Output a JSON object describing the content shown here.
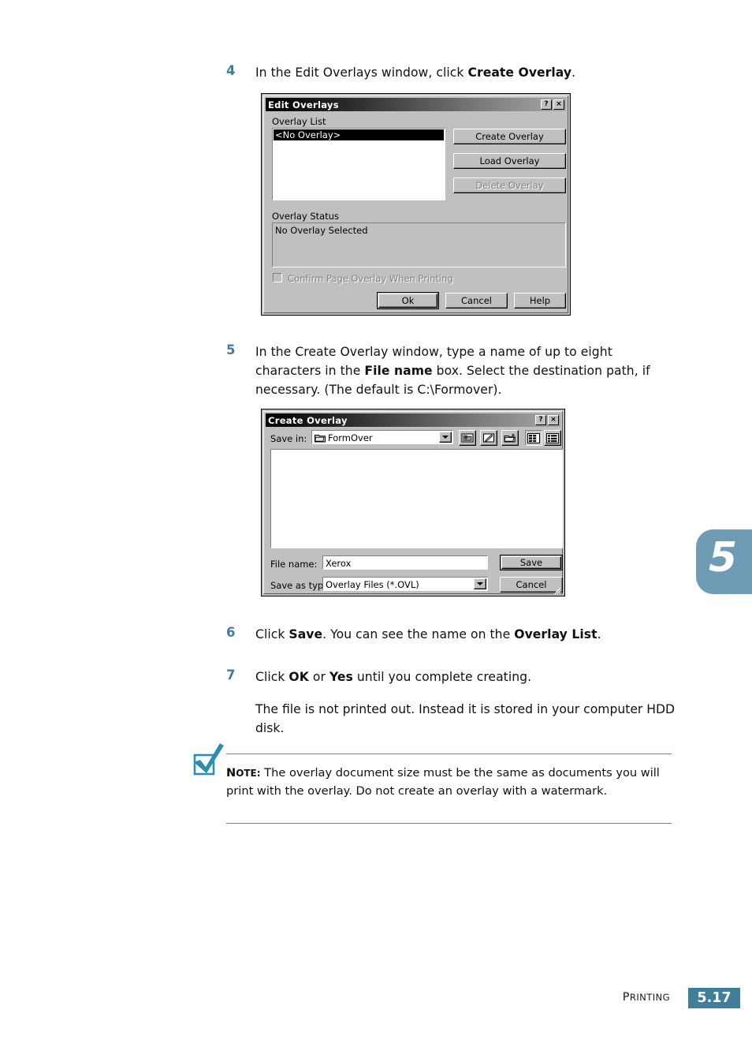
{
  "page": {
    "chapter_tab_number": "5",
    "footer_label": "PRINTING",
    "footer_page": "5.17",
    "accent_color": "#3f7e96",
    "tab_color": "#6d9cb4"
  },
  "steps": [
    {
      "number": "4",
      "text_parts": [
        {
          "t": "In the Edit Overlays window, click ",
          "b": false
        },
        {
          "t": "Create Overlay",
          "b": true
        },
        {
          "t": ".",
          "b": false
        }
      ]
    },
    {
      "number": "5",
      "text_parts": [
        {
          "t": "In the Create Overlay window, type a name of up to eight characters in the ",
          "b": false
        },
        {
          "t": "File name",
          "b": true
        },
        {
          "t": " box. Select the destination path, if necessary. (The default is C:\\Formover).",
          "b": false
        }
      ]
    },
    {
      "number": "6",
      "text_parts": [
        {
          "t": "Click ",
          "b": false
        },
        {
          "t": "Save",
          "b": true
        },
        {
          "t": ". You can see the name on the ",
          "b": false
        },
        {
          "t": "Overlay List",
          "b": true
        },
        {
          "t": ".",
          "b": false
        }
      ]
    },
    {
      "number": "7",
      "text_parts": [
        {
          "t": "Click ",
          "b": false
        },
        {
          "t": "OK",
          "b": true
        },
        {
          "t": " or ",
          "b": false
        },
        {
          "t": "Yes",
          "b": true
        },
        {
          "t": " until you complete creating.",
          "b": false
        }
      ]
    }
  ],
  "step7_followup": "The file is not printed out. Instead it is stored in your computer HDD disk.",
  "note": {
    "keyword": "NOTE:",
    "keyword_first": "N",
    "keyword_rest": "OTE:",
    "body": " The overlay document size must be the same as documents you will print with the overlay. Do not create an overlay with a watermark.",
    "icon": "checkmark-icon",
    "icon_color": "#2d8fb0"
  },
  "edit_overlays_dialog": {
    "title": "Edit Overlays",
    "help_button": "?",
    "close_button": "×",
    "overlay_list_label": "Overlay List",
    "overlay_list_items": [
      "<No Overlay>"
    ],
    "overlay_list_selected": "<No Overlay>",
    "buttons": [
      {
        "label": "Create Overlay",
        "enabled": true,
        "name": "create-overlay-button"
      },
      {
        "label": "Load Overlay",
        "enabled": true,
        "name": "load-overlay-button"
      },
      {
        "label": "Delete Overlay",
        "enabled": false,
        "name": "delete-overlay-button"
      }
    ],
    "overlay_status_label": "Overlay Status",
    "overlay_status_value": "No Overlay Selected",
    "confirm_checkbox_label": "Confirm Page Overlay When Printing",
    "confirm_checkbox_checked": false,
    "confirm_checkbox_enabled": false,
    "ok_button": "Ok",
    "cancel_button": "Cancel",
    "help_button_label": "Help"
  },
  "create_overlay_dialog": {
    "title": "Create Overlay",
    "help_button": "?",
    "close_button": "×",
    "save_in_label": "Save in:",
    "save_in_value": "FormOver",
    "toolbar_icons": [
      {
        "name": "up-one-level-icon",
        "pressed": false
      },
      {
        "name": "create-new-folder-icon",
        "pressed": false
      },
      {
        "name": "new-folder-star-icon",
        "pressed": false
      },
      {
        "name": "list-view-icon",
        "pressed": true
      },
      {
        "name": "details-view-icon",
        "pressed": false
      }
    ],
    "file_list_items": [],
    "file_name_label": "File name:",
    "file_name_value": "Xerox",
    "save_as_type_label": "Save as type:",
    "save_as_type_value": "Overlay Files (*.OVL)",
    "save_button": "Save",
    "cancel_button": "Cancel"
  }
}
